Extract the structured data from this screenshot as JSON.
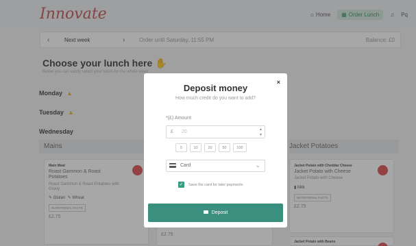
{
  "brand": {
    "logo_text": "Innovate"
  },
  "nav": {
    "home": "Home",
    "order_lunch": "Order Lunch",
    "profile": "Pq"
  },
  "week": {
    "prev": "‹",
    "label": "Next week",
    "next": "›",
    "order_until": "Order until Saturday, 11:55 PM",
    "balance": "Balance: £0"
  },
  "page": {
    "title": "Choose your lunch here",
    "hint": "Below you can easily select your lunch for the whole week"
  },
  "days": [
    {
      "name": "Monday"
    },
    {
      "name": "Tuesday"
    },
    {
      "name": "Wednesday"
    }
  ],
  "columns": {
    "mains": "Mains",
    "jacket": "Jacket Potatoes"
  },
  "main_card": {
    "category": "Main Meal",
    "name": "Roast Gammon & Roast Potatoes",
    "desc": "Roast Gammon & Roast Potatoes with Gravy",
    "tag1": "Gluten",
    "tag2": "Wheat",
    "nutrition": "NUTRITIONAL FACTS",
    "price": "£2.75"
  },
  "middle_card": {
    "price": "£2.75"
  },
  "jacket_card": {
    "category": "Jacket Potato with Cheddar Cheese",
    "name": "Jacket Potato with Cheese",
    "desc": "Jacket Potato with Cheese",
    "tag": "Milk",
    "nutrition": "NUTRITIONAL FACTS",
    "price": "£2.75"
  },
  "jacket_card2": {
    "category": "Jacket Potato with Beans"
  },
  "modal": {
    "close": "×",
    "title": "Deposit money",
    "subtitle": "How much credit do you want to add?",
    "amount_label": "*(£) Amount",
    "currency": "£",
    "amount_placeholder": "20",
    "presets": [
      "5",
      "10",
      "20",
      "50",
      "100"
    ],
    "payment_method": "Card",
    "save_card_label": "Save the card for later payments",
    "save_card_checked": true,
    "deposit_button": "Deposit"
  },
  "colors": {
    "accent": "#3a8f7e",
    "danger": "#d94848",
    "logo": "#c24b4b",
    "warning": "#e9b422"
  }
}
